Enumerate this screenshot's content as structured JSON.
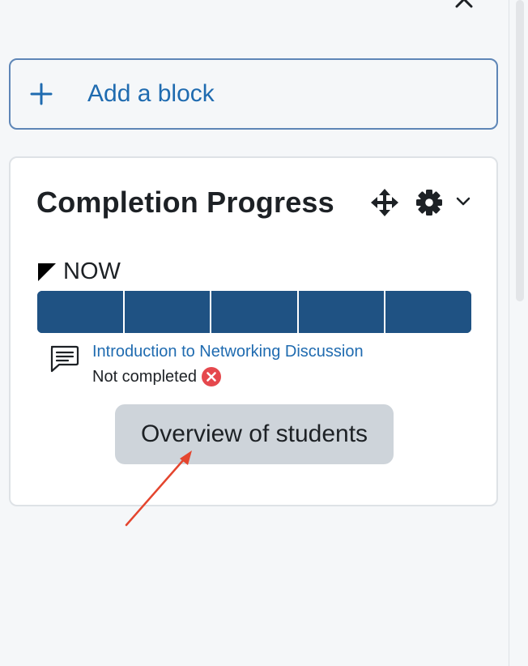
{
  "add_block": {
    "label": "Add a block",
    "icon": "plus-icon"
  },
  "block": {
    "title": "Completion Progress",
    "icons": [
      "move-icon",
      "gear-icon",
      "chevron-down-icon"
    ],
    "now_label": "NOW",
    "progress_cells": 5,
    "activity": {
      "name": "Introduction to Networking Discussion",
      "status": "Not completed",
      "icon": "forum-icon",
      "status_icon": "cross-circle-icon"
    },
    "overview_button": "Overview of students"
  },
  "colors": {
    "accent": "#1f6bb0",
    "progress": "#1f5283",
    "incomplete": "#e5484d",
    "annotation_arrow": "#e4452e"
  }
}
